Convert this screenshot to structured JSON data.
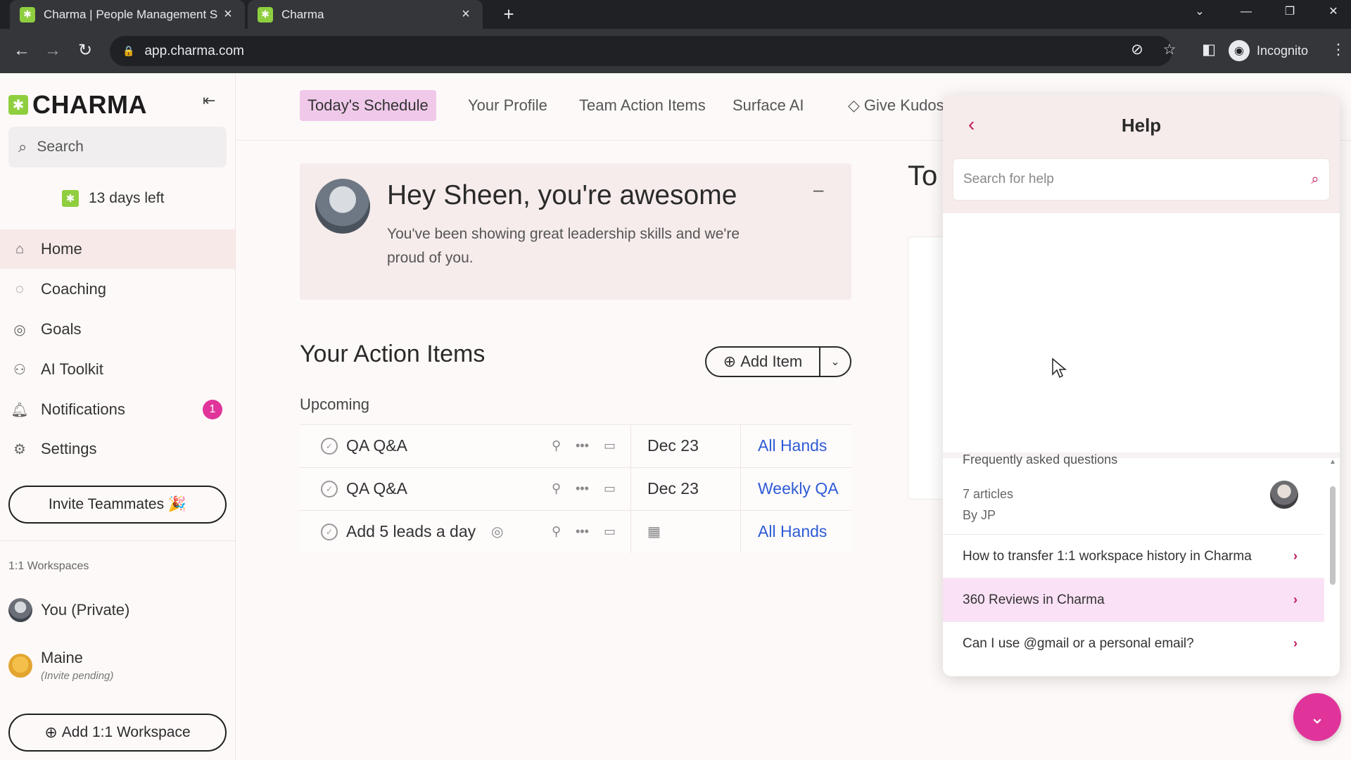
{
  "browser": {
    "tabs": [
      {
        "title": "Charma | People Management S",
        "favicon": "charma-favicon"
      },
      {
        "title": "Charma",
        "favicon": "charma-favicon"
      }
    ],
    "url": "app.charma.com",
    "incognito_label": "Incognito"
  },
  "sidebar": {
    "logo_text": "CHARMA",
    "search_placeholder": "Search",
    "trial_text": "13 days left",
    "nav": [
      {
        "label": "Home",
        "icon": "home-icon"
      },
      {
        "label": "Coaching",
        "icon": "coaching-icon"
      },
      {
        "label": "Goals",
        "icon": "target-icon"
      },
      {
        "label": "AI Toolkit",
        "icon": "robot-icon"
      },
      {
        "label": "Notifications",
        "icon": "bell-icon",
        "badge": "1"
      },
      {
        "label": "Settings",
        "icon": "gear-icon"
      }
    ],
    "invite_label": "Invite Teammates 🎉",
    "workspaces_title": "1:1 Workspaces",
    "workspaces": [
      {
        "name": "You (Private)"
      },
      {
        "name": "Maine",
        "sub": "(Invite pending)"
      }
    ],
    "add_workspace_label": "Add 1:1 Workspace"
  },
  "topnav": {
    "tabs": [
      "Today's Schedule",
      "Your Profile",
      "Team Action Items",
      "Surface AI",
      "Give Kudos"
    ]
  },
  "kudos": {
    "title": "Hey Sheen, you're awesome",
    "body": "You've been showing great leadership skills and we're proud of you.",
    "minimize_label": "–"
  },
  "action_items": {
    "title": "Your Action Items",
    "add_label": "Add Item",
    "section": "Upcoming",
    "rows": [
      {
        "label": "QA Q&A",
        "date": "Dec 23",
        "meeting": "All Hands"
      },
      {
        "label": "QA Q&A",
        "date": "Dec 23",
        "meeting": "Weekly QA"
      },
      {
        "label": "Add 5 leads a day",
        "date": "",
        "meeting": "All Hands"
      }
    ]
  },
  "right_panel": {
    "title_peek": "To"
  },
  "help": {
    "title": "Help",
    "search_placeholder": "Search for help",
    "collection_title": "Frequently asked questions",
    "collection_count": "7 articles",
    "collection_author": "By JP",
    "articles": [
      "How to transfer 1:1 workspace history in Charma",
      "360 Reviews in Charma",
      "Can I use @gmail or a personal email?"
    ]
  },
  "colors": {
    "accent_pink": "#e0349b",
    "brand_green": "#8fcf3f",
    "link_blue": "#2e5bd6",
    "active_tab": "#f0c9ea"
  }
}
